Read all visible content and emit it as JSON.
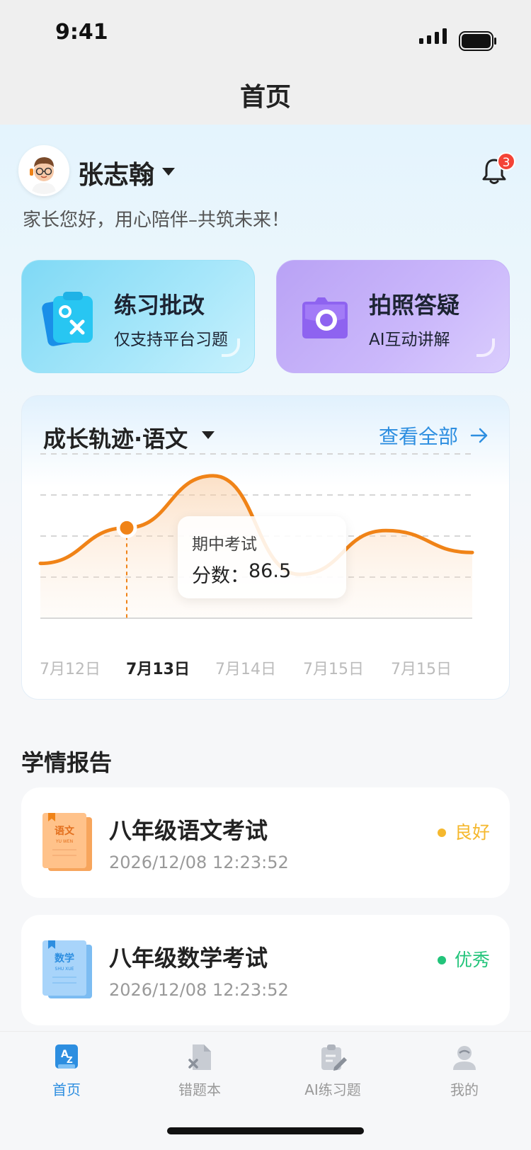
{
  "status_bar": {
    "time": "9:41"
  },
  "nav": {
    "title": "首页"
  },
  "user": {
    "name": "张志翰",
    "greeting": "家长您好，用心陪伴–共筑未来！",
    "notification_count": "3"
  },
  "features": [
    {
      "title": "练习批改",
      "subtitle": "仅支持平台习题",
      "icon": "practice-icon"
    },
    {
      "title": "拍照答疑",
      "subtitle": "AI互动讲解",
      "icon": "camera-icon"
    }
  ],
  "growth": {
    "title": "成长轨迹·语文",
    "view_all": "查看全部",
    "tooltip": {
      "label": "期中考试",
      "score_label": "分数：",
      "score": "86.5"
    }
  },
  "chart_data": {
    "type": "line",
    "categories": [
      "7月12日",
      "7月13日",
      "7月14日",
      "7月15日",
      "7月15日"
    ],
    "active_category": "7月13日",
    "series": [
      {
        "values": [
          80,
          86.5,
          96,
          78,
          86,
          82
        ]
      }
    ],
    "grid": true,
    "line_color": "#f08317"
  },
  "reports": {
    "title": "学情报告",
    "items": [
      {
        "title": "八年级语文考试",
        "time": "2026/12/08 12:23:52",
        "status": "良好",
        "status_color": "#f5b82e",
        "book": "语文"
      },
      {
        "title": "八年级数学考试",
        "time": "2026/12/08 12:23:52",
        "status": "优秀",
        "status_color": "#22c47a",
        "book": "数学"
      }
    ]
  },
  "tabs": [
    {
      "label": "首页",
      "icon": "home-az-icon",
      "active": true
    },
    {
      "label": "错题本",
      "icon": "wrong-book-icon",
      "active": false
    },
    {
      "label": "AI练习题",
      "icon": "ai-exercise-icon",
      "active": false
    },
    {
      "label": "我的",
      "icon": "profile-icon",
      "active": false
    }
  ],
  "colors": {
    "accent": "#2d8ee0",
    "chart_line": "#f08317"
  }
}
